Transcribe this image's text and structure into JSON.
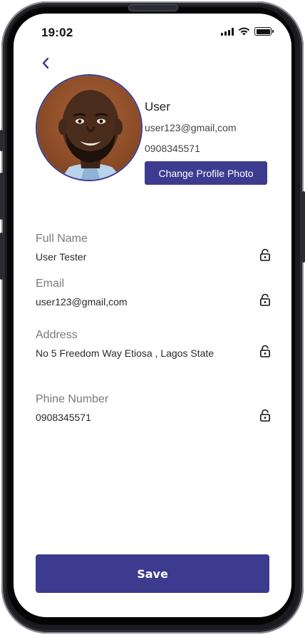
{
  "status_bar": {
    "time": "19:02",
    "battery_level": 1.0
  },
  "header": {
    "back_icon": "chevron-left-icon"
  },
  "profile": {
    "name": "User",
    "email": "user123@gmail,com",
    "phone": "0908345571",
    "change_photo_label": "Change Profile Photo",
    "avatar_icon": "person-photo"
  },
  "fields": [
    {
      "label": "Full Name",
      "value": "User Tester",
      "icon": "lock-icon"
    },
    {
      "label": "Email",
      "value": "user123@gmail,com",
      "icon": "lock-icon"
    },
    {
      "label": "Address",
      "value": "No 5 Freedom Way Etiosa , Lagos State",
      "icon": "lock-icon"
    },
    {
      "label": "Phine Number",
      "value": "0908345571",
      "icon": "lock-icon"
    }
  ],
  "save_label": "Save",
  "colors": {
    "primary": "#3d3b8f",
    "label": "#7a7a7a",
    "text": "#2a2a2a"
  }
}
